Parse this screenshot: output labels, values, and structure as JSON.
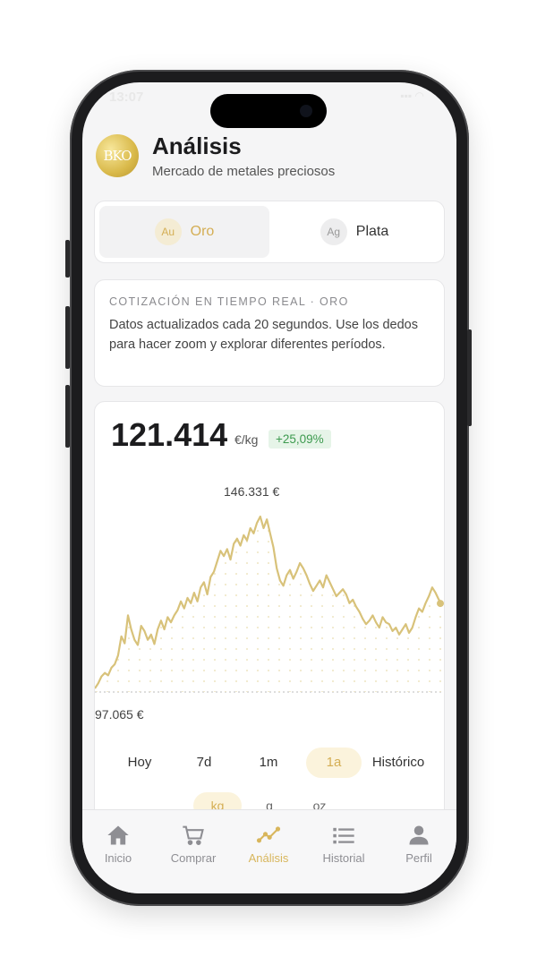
{
  "status": {
    "time": "13:07",
    "icons": "▪▪▪ ◠"
  },
  "header": {
    "logo_text": "BKO",
    "title": "Análisis",
    "subtitle": "Mercado de metales preciosos"
  },
  "metal_toggle": [
    {
      "symbol": "Au",
      "label": "Oro",
      "active": true
    },
    {
      "symbol": "Ag",
      "label": "Plata",
      "active": false
    }
  ],
  "info": {
    "title": "COTIZACIÓN EN TIEMPO REAL · ORO",
    "text": "Datos actualizados cada 20 segundos. Use los dedos para hacer zoom y explorar diferentes períodos."
  },
  "chart": {
    "price": "121.414",
    "unit": "€/kg",
    "change": "+25,09%",
    "max_label": "146.331 €",
    "min_label": "97.065 €"
  },
  "chart_data": {
    "type": "line",
    "title": "",
    "color": "#d8c27a",
    "min": 97065,
    "max": 146331,
    "values": [
      97065,
      98500,
      100500,
      101500,
      100800,
      103000,
      104000,
      106500,
      112000,
      110000,
      118000,
      114000,
      111000,
      109500,
      115000,
      113500,
      111000,
      112500,
      109800,
      114000,
      116500,
      114000,
      117500,
      116000,
      118000,
      119500,
      122000,
      120000,
      123000,
      121500,
      124500,
      122000,
      126000,
      127500,
      124000,
      129000,
      130500,
      133500,
      136500,
      135000,
      137000,
      134000,
      138500,
      140000,
      138000,
      141000,
      139500,
      143000,
      141500,
      144500,
      146331,
      143000,
      145500,
      141500,
      137500,
      131500,
      128000,
      126500,
      129500,
      131000,
      128500,
      130500,
      133000,
      131500,
      129500,
      127000,
      125000,
      126500,
      128000,
      126000,
      129500,
      127500,
      125500,
      123500,
      124500,
      125500,
      124000,
      121500,
      122500,
      120500,
      119000,
      117000,
      115500,
      116500,
      118000,
      116000,
      114500,
      117500,
      116000,
      115500,
      113500,
      114500,
      112500,
      114000,
      115500,
      113000,
      114500,
      117500,
      120000,
      119000,
      121500,
      123500,
      126000,
      124500,
      122500,
      121414
    ],
    "periods": [
      "Hoy",
      "7d",
      "1m",
      "1a",
      "Histórico"
    ],
    "active_period": "1a",
    "units": [
      "kg",
      "g",
      "oz"
    ],
    "active_unit": "kg"
  },
  "tabbar": [
    {
      "icon": "home-icon",
      "label": "Inicio",
      "active": false
    },
    {
      "icon": "cart-icon",
      "label": "Comprar",
      "active": false
    },
    {
      "icon": "chart-line-icon",
      "label": "Análisis",
      "active": true
    },
    {
      "icon": "list-icon",
      "label": "Historial",
      "active": false
    },
    {
      "icon": "person-icon",
      "label": "Perfil",
      "active": false
    }
  ]
}
